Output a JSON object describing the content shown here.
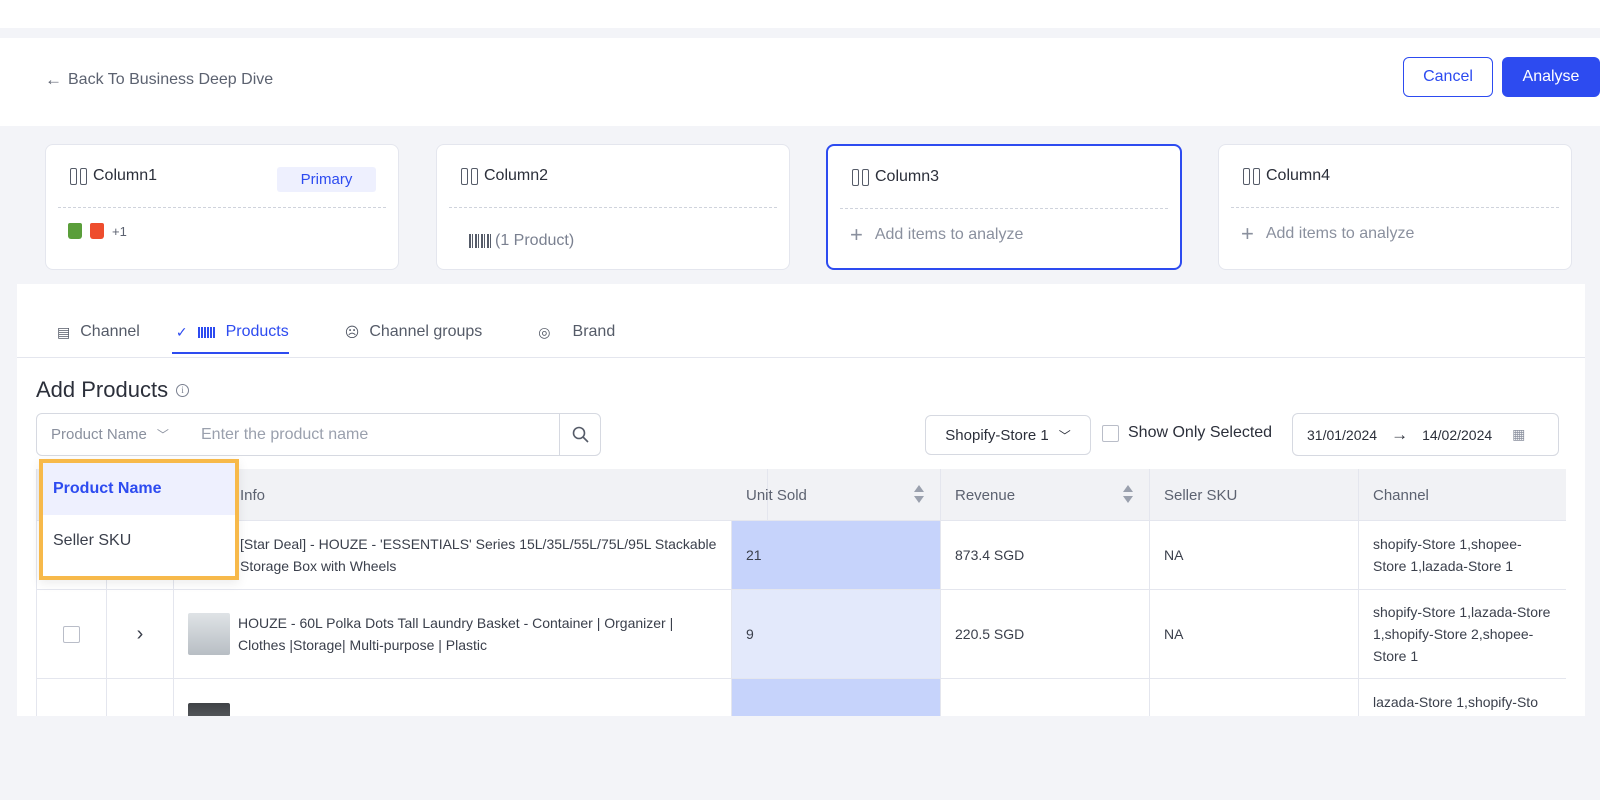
{
  "header": {
    "back_label": "Back To Business Deep Dive",
    "cancel_label": "Cancel",
    "analyse_label": "Analyse"
  },
  "columns": [
    {
      "title": "Column1",
      "tag": "Primary",
      "channels_more": "+1"
    },
    {
      "title": "Column2",
      "product_count": "(1 Product)"
    },
    {
      "title": "Column3",
      "add_label": "Add items to analyze"
    },
    {
      "title": "Column4",
      "add_label": "Add items to analyze"
    }
  ],
  "tabs": [
    {
      "label": "Channel",
      "icon": "store-icon"
    },
    {
      "label": "Products",
      "icon": "barcode-icon",
      "active": true
    },
    {
      "label": "Channel groups",
      "icon": "group-icon"
    },
    {
      "label": "Brand",
      "icon": "badge-icon"
    }
  ],
  "section": {
    "title": "Add Products",
    "search_type_value": "Product Name",
    "search_placeholder": "Enter the product name",
    "store_select_value": "Shopify-Store 1",
    "show_only_selected": "Show Only Selected",
    "date_from": "31/01/2024",
    "date_arrow": "→",
    "date_to": "14/02/2024"
  },
  "dropdown": {
    "options": [
      "Product Name",
      "Seller SKU"
    ],
    "selected": "Product Name"
  },
  "table": {
    "headers": {
      "info": "Info",
      "unit_sold": "Unit Sold",
      "revenue": "Revenue",
      "seller_sku": "Seller SKU",
      "channel": "Channel"
    },
    "rows": [
      {
        "info": "[Star Deal] - HOUZE - 'ESSENTIALS' Series 15L/35L/55L/75L/95L Stackable Storage Box with Wheels",
        "unit_sold": "21",
        "revenue": "873.4 SGD",
        "seller_sku": "NA",
        "channel": "shopify-Store 1,shopee-Store 1,lazada-Store 1"
      },
      {
        "info": "HOUZE - 60L Polka Dots Tall Laundry Basket - Container | Organizer | Clothes |Storage| Multi-purpose | Plastic",
        "unit_sold": "9",
        "revenue": "220.5 SGD",
        "seller_sku": "NA",
        "channel": "shopify-Store 1,lazada-Store 1,shopify-Store 2,shopee-Store 1"
      },
      {
        "info": "",
        "unit_sold": "",
        "revenue": "",
        "seller_sku": "",
        "channel": "lazada-Store 1,shopify-Sto"
      }
    ]
  },
  "colors": {
    "accent": "#2d4bf0",
    "highlight_border": "#f7b94a",
    "unit_sold_bg": "#e3e9fb"
  }
}
